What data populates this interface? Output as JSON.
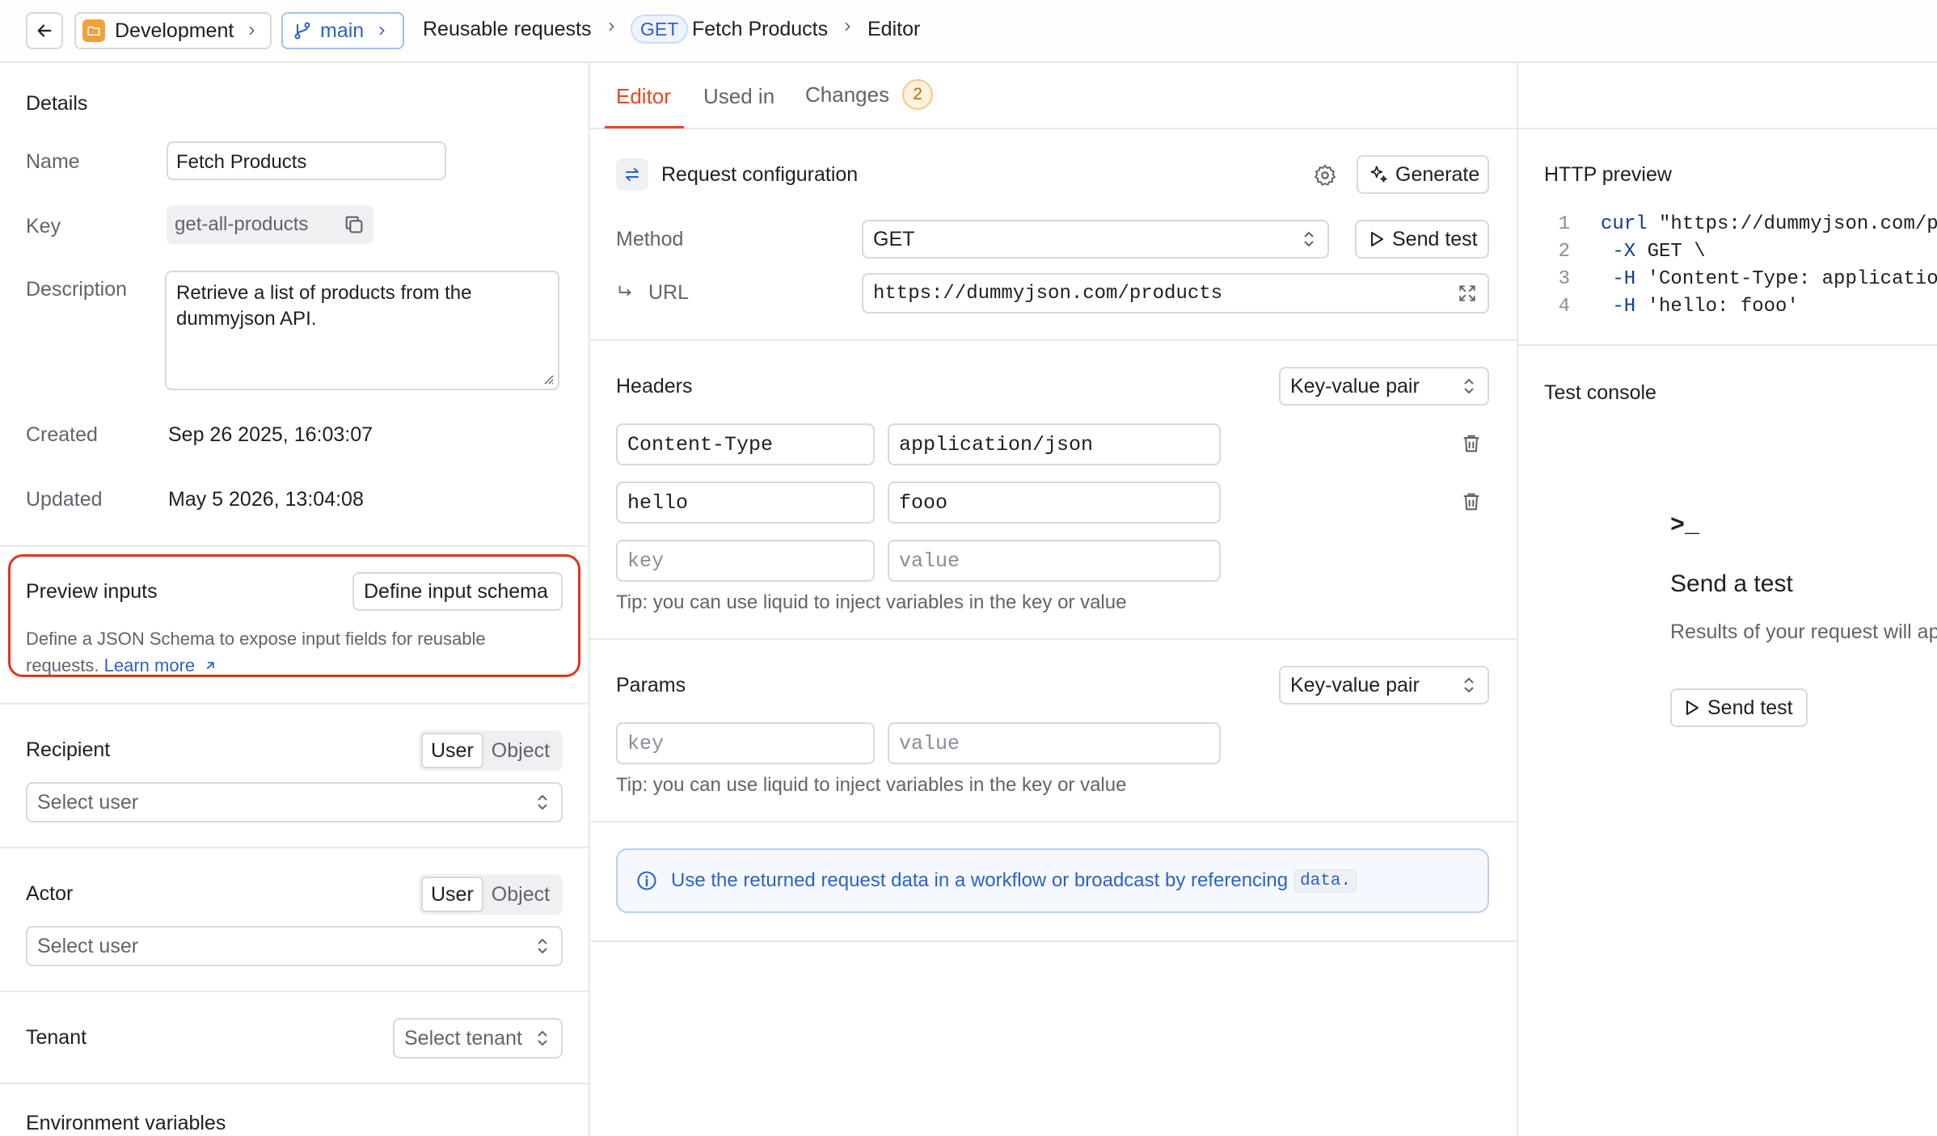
{
  "topbar": {
    "back_label": "←",
    "environment": "Development",
    "branch": "main",
    "breadcrumb": {
      "section": "Reusable requests",
      "method": "GET",
      "request": "Fetch Products",
      "page": "Editor"
    }
  },
  "details": {
    "title": "Details",
    "name_label": "Name",
    "name_value": "Fetch Products",
    "key_label": "Key",
    "key_value": "get-all-products",
    "description_label": "Description",
    "description_value": "Retrieve a list of products from the dummyjson API.",
    "created_label": "Created",
    "created_value": "Sep 26 2025, 16:03:07",
    "updated_label": "Updated",
    "updated_value": "May 5 2026, 13:04:08"
  },
  "preview_inputs": {
    "title": "Preview inputs",
    "define_button": "Define input schema",
    "help_text": "Define a JSON Schema to expose input fields for reusable requests.",
    "learn_more": "Learn more",
    "highlight_color": "#e5331e"
  },
  "recipient": {
    "title": "Recipient",
    "seg_user": "User",
    "seg_object": "Object",
    "select_placeholder": "Select user"
  },
  "actor": {
    "title": "Actor",
    "seg_user": "User",
    "seg_object": "Object",
    "select_placeholder": "Select user"
  },
  "tenant": {
    "title": "Tenant",
    "select_placeholder": "Select tenant"
  },
  "env_vars": {
    "title": "Environment variables"
  },
  "tabs": {
    "editor": "Editor",
    "used_in": "Used in",
    "changes": "Changes",
    "changes_count": "2",
    "accent": "#e5491e"
  },
  "request_config": {
    "title": "Request configuration",
    "generate_button": "Generate",
    "method_label": "Method",
    "method_value": "GET",
    "send_test_button": "Send test",
    "url_label": "URL",
    "url_value": "https://dummyjson.com/products"
  },
  "headers": {
    "title": "Headers",
    "mode": "Key-value pair",
    "rows": [
      {
        "key": "Content-Type",
        "value": "application/json"
      },
      {
        "key": "hello",
        "value": "fooo"
      }
    ],
    "key_placeholder": "key",
    "value_placeholder": "value",
    "tip": "Tip: you can use liquid to inject variables in the key or value"
  },
  "params": {
    "title": "Params",
    "mode": "Key-value pair",
    "key_placeholder": "key",
    "value_placeholder": "value",
    "tip": "Tip: you can use liquid to inject variables in the key or value"
  },
  "info_banner": {
    "text": "Use the returned request data in a workflow or broadcast by referencing",
    "code": "data."
  },
  "http_preview": {
    "title": "HTTP preview",
    "lines": [
      {
        "n": "1",
        "flag": "curl",
        "rest": " \"https://dummyjson.com/products\""
      },
      {
        "n": "2",
        "flag": " -X",
        "rest": " GET \\"
      },
      {
        "n": "3",
        "flag": " -H",
        "rest": " 'Content-Type: application/json'"
      },
      {
        "n": "4",
        "flag": " -H",
        "rest": " 'hello: fooo'"
      }
    ]
  },
  "test_console": {
    "title": "Test console",
    "prompt_icon": ">_",
    "heading": "Send a test",
    "subtext": "Results of your request will appear here",
    "button": "Send test"
  }
}
